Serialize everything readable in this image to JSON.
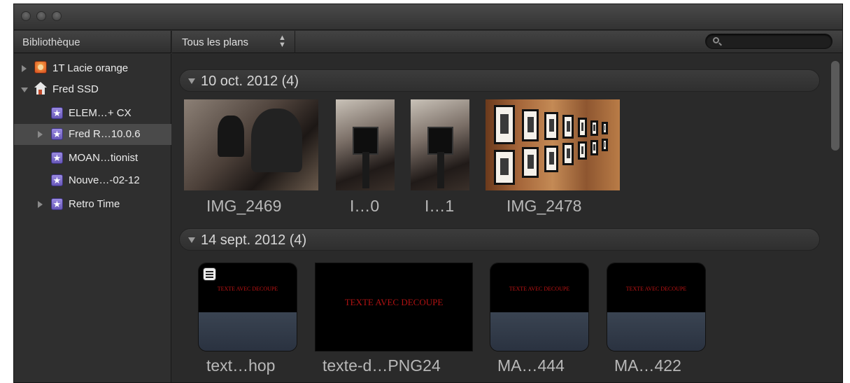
{
  "sidebar": {
    "title": "Bibliothèque",
    "items": [
      {
        "label": "1T Lacie orange",
        "icon": "drive-icon"
      },
      {
        "label": "Fred SSD",
        "icon": "house-icon"
      },
      {
        "label": "ELEM…+ CX",
        "icon": "event-star-icon"
      },
      {
        "label": "Fred R…10.0.6",
        "icon": "event-star-icon",
        "selected": true
      },
      {
        "label": "MOAN…tionist",
        "icon": "event-star-icon"
      },
      {
        "label": "Nouve…-02-12",
        "icon": "event-star-icon"
      },
      {
        "label": "Retro Time",
        "icon": "event-star-icon"
      }
    ]
  },
  "browser": {
    "filter_label": "Tous les plans",
    "search_placeholder": ""
  },
  "groups": [
    {
      "title": "10 oct. 2012  (4)",
      "clips": [
        {
          "name": "IMG_2469"
        },
        {
          "name": "I…0"
        },
        {
          "name": "I…1"
        },
        {
          "name": "IMG_2478"
        }
      ]
    },
    {
      "title": "14 sept. 2012  (4)",
      "clips": [
        {
          "name": "text…hop",
          "overlay_text": "TEXTE AVEC DECOUPE"
        },
        {
          "name": "texte-d…PNG24",
          "overlay_text": "TEXTE AVEC DECOUPE"
        },
        {
          "name": "MA…444",
          "overlay_text": "TEXTE AVEC DECOUPE"
        },
        {
          "name": "MA…422",
          "overlay_text": "TEXTE AVEC DECOUPE"
        }
      ]
    }
  ],
  "colors": {
    "window_bg": "#2b2b2b",
    "selection": "#4a4a4a",
    "event_icon": "#7a6ad0",
    "overlay_text": "#c01414"
  }
}
